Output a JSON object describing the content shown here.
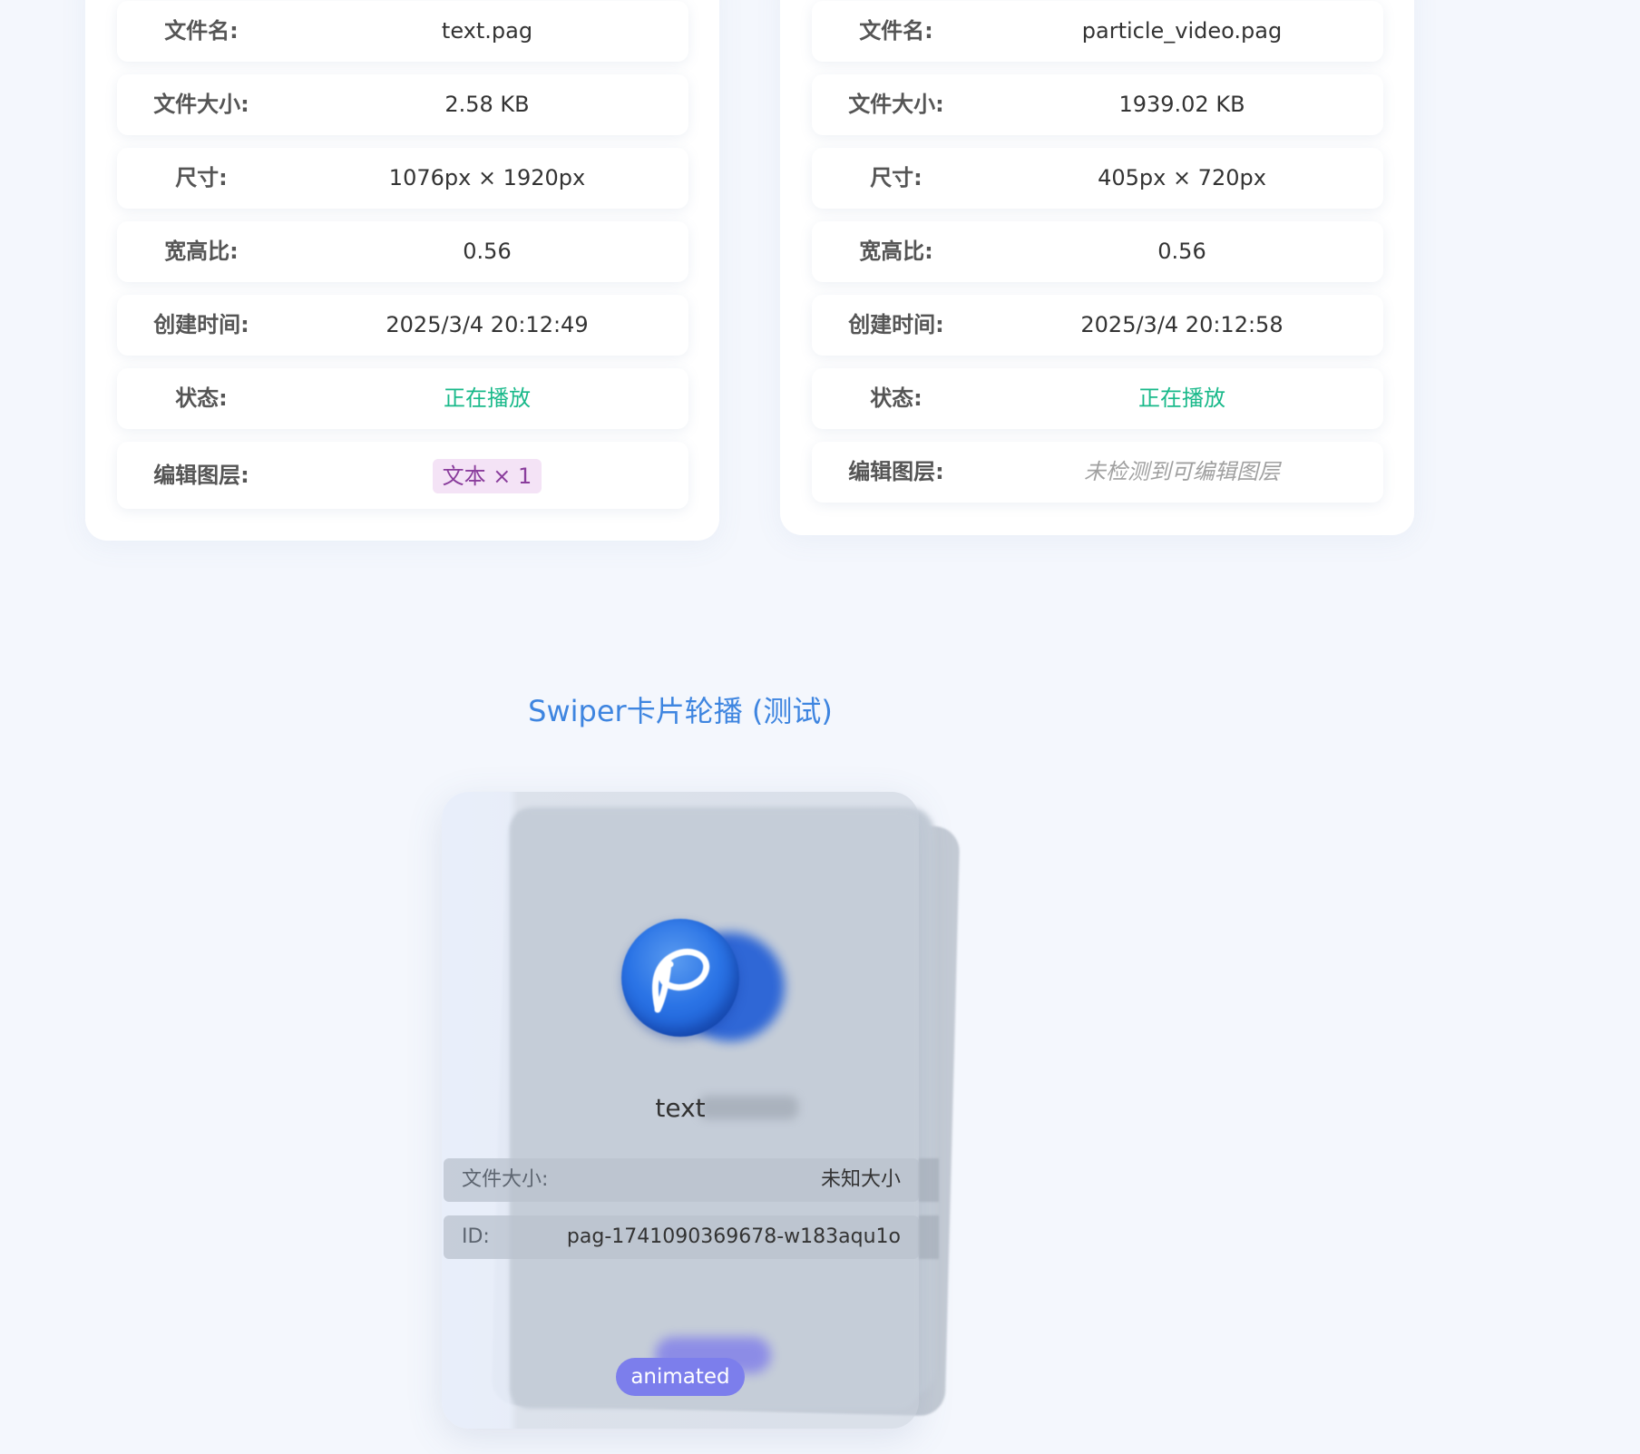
{
  "panels": [
    {
      "rows": [
        {
          "label": "文件名:",
          "value": "text.pag"
        },
        {
          "label": "文件大小:",
          "value": "2.58 KB"
        },
        {
          "label": "尺寸:",
          "value": "1076px × 1920px"
        },
        {
          "label": "宽高比:",
          "value": "0.56"
        },
        {
          "label": "创建时间:",
          "value": "2025/3/4 20:12:49"
        },
        {
          "label": "状态:",
          "value": "正在播放"
        },
        {
          "label": "编辑图层:",
          "value": "文本 × 1"
        }
      ]
    },
    {
      "rows": [
        {
          "label": "文件名:",
          "value": "particle_video.pag"
        },
        {
          "label": "文件大小:",
          "value": "1939.02 KB"
        },
        {
          "label": "尺寸:",
          "value": "405px × 720px"
        },
        {
          "label": "宽高比:",
          "value": "0.56"
        },
        {
          "label": "创建时间:",
          "value": "2025/3/4 20:12:58"
        },
        {
          "label": "状态:",
          "value": "正在播放"
        },
        {
          "label": "编辑图层:",
          "value": "未检测到可编辑图层"
        }
      ]
    }
  ],
  "swiper": {
    "title": "Swiper卡片轮播 (测试)",
    "card": {
      "name": "text",
      "size_label": "文件大小:",
      "size_value": "未知大小",
      "id_label": "ID:",
      "id_value": "pag-1741090369678-w183aqu1o",
      "badge": "animated",
      "logo_icon": "pag-logo-icon"
    }
  },
  "colors": {
    "playing": "#19b98a",
    "title": "#3e85e0",
    "badge": "#7c7eec",
    "tag_bg": "#f4e3f6",
    "tag_text": "#8a3d9c"
  }
}
